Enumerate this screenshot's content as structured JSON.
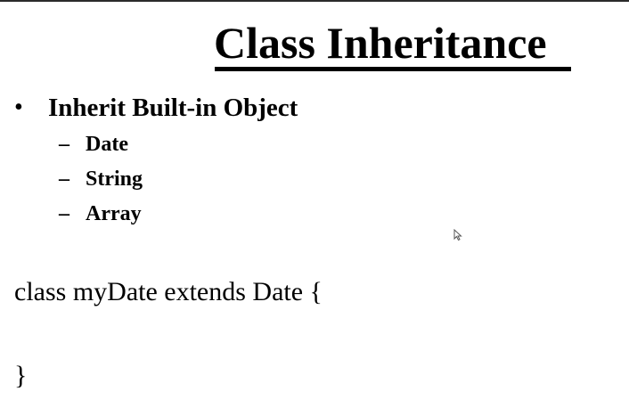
{
  "slide": {
    "title": "Class Inheritance",
    "bullet": {
      "symbol": "•",
      "text": "Inherit Built-in Object"
    },
    "sub_items": [
      {
        "dash": "–",
        "text": "Date"
      },
      {
        "dash": "–",
        "text": "String"
      },
      {
        "dash": "–",
        "text": "Array"
      }
    ],
    "code": {
      "line1": "class myDate extends Date {",
      "line2": "}"
    }
  },
  "colors": {
    "background": "#ffffff",
    "text": "#000000",
    "top_border": "#2a2a2a"
  },
  "icons": {
    "cursor": "mouse-pointer-icon"
  }
}
